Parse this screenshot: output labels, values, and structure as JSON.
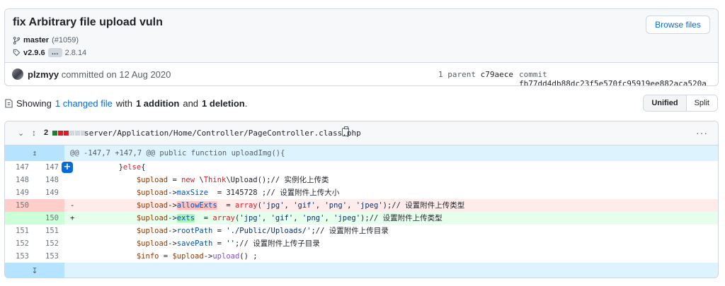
{
  "commit": {
    "title": "fix Arbitrary file upload vuln",
    "branch": "master",
    "pr": "(#1059)",
    "tag": "v2.9.6",
    "tag_more": "…",
    "tag_other": "2.8.14",
    "browse_files_label": "Browse files",
    "author": "plzmyy",
    "committed_text": "committed on 12 Aug 2020",
    "parent_label": "1 parent",
    "parent_sha": "c79aece",
    "commit_label": "commit",
    "commit_sha": "fb77dd4db88dc23f5e570fc95919ee882aca520a"
  },
  "summary": {
    "prefix": "Showing",
    "files_link": "1 changed file",
    "with": "with",
    "additions": "1 addition",
    "and": "and",
    "deletions": "1 deletion",
    "suffix": "."
  },
  "view_toggle": {
    "unified": "Unified",
    "split": "Split"
  },
  "file": {
    "change_count": "2",
    "path": "server/Application/Home/Controller/PageController.class.php",
    "hunk_header": "@@ -147,7 +147,7 @@ public function uploadImg(){",
    "diffstat_colors": [
      "#1a7f37",
      "#cf222e",
      "#cf222e",
      "#d0d7de",
      "#d0d7de",
      "#d0d7de"
    ],
    "lines": [
      {
        "type": "ctx",
        "old": "147",
        "new": "147",
        "marker": "",
        "code": "        }else{"
      },
      {
        "type": "ctx",
        "old": "148",
        "new": "148",
        "marker": "",
        "code": "            $upload = new \\Think\\Upload();// 实例化上传类"
      },
      {
        "type": "ctx",
        "old": "149",
        "new": "149",
        "marker": "",
        "code": "            $upload->maxSize  = 3145728 ;// 设置附件上传大小"
      },
      {
        "type": "del",
        "old": "150",
        "new": "",
        "marker": "-",
        "code": "            $upload->allowExts  = array('jpg', 'gif', 'png', 'jpeg');// 设置附件上传类型"
      },
      {
        "type": "add",
        "old": "",
        "new": "150",
        "marker": "+",
        "code": "            $upload->exts  = array('jpg', 'gif', 'png', 'jpeg');// 设置附件上传类型"
      },
      {
        "type": "ctx",
        "old": "151",
        "new": "151",
        "marker": "",
        "code": "            $upload->rootPath = './Public/Uploads/';// 设置附件上传目录"
      },
      {
        "type": "ctx",
        "old": "152",
        "new": "152",
        "marker": "",
        "code": "            $upload->savePath = '';// 设置附件上传子目录"
      },
      {
        "type": "ctx",
        "old": "153",
        "new": "153",
        "marker": "",
        "code": "            $info = $upload->upload() ;"
      }
    ]
  },
  "icons": {
    "branch": "git-branch-icon",
    "tag": "tag-icon",
    "file_diff": "file-diff-icon",
    "chevron": "chevron-down-icon",
    "expand": "unfold-icon",
    "copy": "copy-icon",
    "kebab": "kebab-horizontal-icon"
  }
}
